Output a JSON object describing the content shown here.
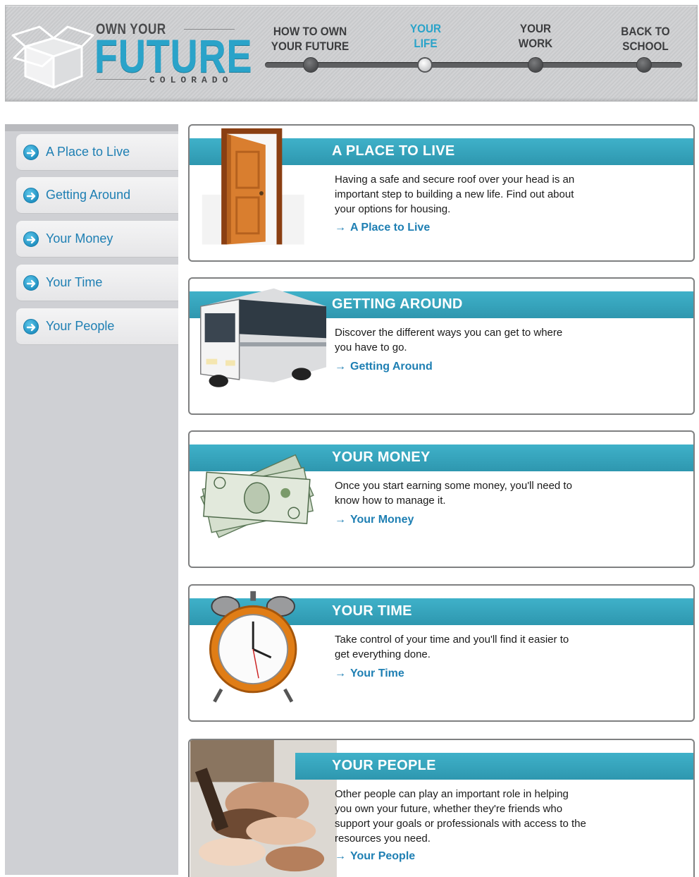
{
  "header": {
    "logo_top": "OWN YOUR",
    "logo_main": "FUTURE",
    "logo_sub": "COLORADO",
    "nav": [
      {
        "line1": "HOW TO OWN",
        "line2": "YOUR FUTURE",
        "active": false
      },
      {
        "line1": "YOUR",
        "line2": "LIFE",
        "active": true
      },
      {
        "line1": "YOUR",
        "line2": "WORK",
        "active": false
      },
      {
        "line1": "BACK TO",
        "line2": "SCHOOL",
        "active": false
      }
    ]
  },
  "sidebar": {
    "items": [
      {
        "label": "A Place to Live"
      },
      {
        "label": "Getting Around"
      },
      {
        "label": "Your Money"
      },
      {
        "label": "Your Time"
      },
      {
        "label": "Your People"
      }
    ]
  },
  "cards": [
    {
      "title": "A PLACE TO LIVE",
      "description": "Having a safe and secure roof over your head is an important step to building a new life. Find out about your options for housing.",
      "link": "A Place to Live"
    },
    {
      "title": "GETTING AROUND",
      "description": "Discover the different ways you can get to where you have to go.",
      "link": "Getting Around"
    },
    {
      "title": "YOUR MONEY",
      "description": "Once you start earning some money, you'll need to know how to manage it.",
      "link": "Your Money"
    },
    {
      "title": "YOUR TIME",
      "description": "Take control of your time and you'll find it easier to get everything done.",
      "link": "Your Time"
    },
    {
      "title": "YOUR PEOPLE",
      "description": "Other people can play an important role in helping you own your future, whether they're friends who support your goals or professionals with access to the resources you need.",
      "link": "Your People"
    }
  ],
  "colors": {
    "accent": "#2aa3c9",
    "band": "#3aa9c1",
    "link": "#1e7fb3",
    "sidebar_bg": "#cfd0d4"
  },
  "icons": [
    "box-logo-icon",
    "door-image",
    "bus-image",
    "money-image",
    "alarm-clock-image",
    "hands-image",
    "arrow-right-icon"
  ]
}
